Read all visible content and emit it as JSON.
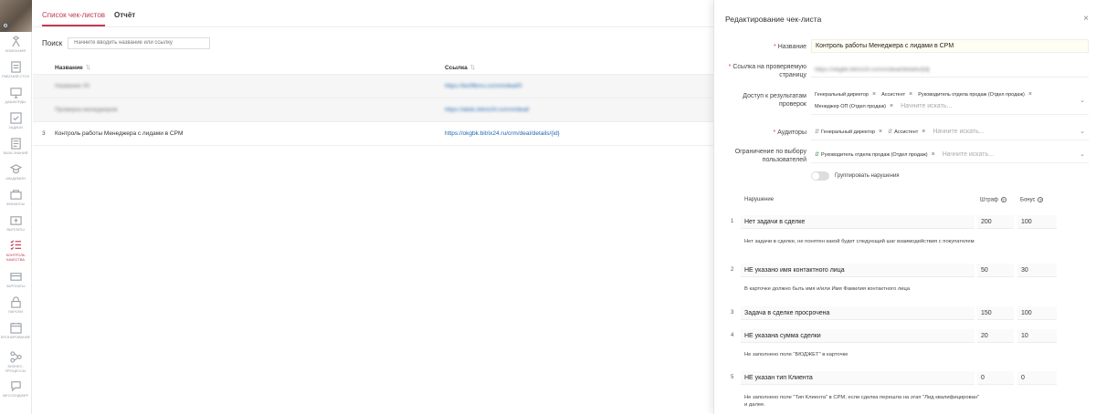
{
  "sidebar": {
    "items": [
      {
        "label": "КОМПАНИЯ",
        "icon": "company-icon"
      },
      {
        "label": "РАБОЧИЙ СТОЛ",
        "icon": "desktop-icon"
      },
      {
        "label": "ДАШБОРДЫ",
        "icon": "dashboard-icon"
      },
      {
        "label": "ЗАДАЧИ",
        "icon": "tasks-icon"
      },
      {
        "label": "БАЗА ЗНАНИЙ",
        "icon": "knowledge-icon"
      },
      {
        "label": "АКАДЕМИЯ",
        "icon": "academy-icon"
      },
      {
        "label": "ФИНАНСЫ",
        "icon": "finance-icon"
      },
      {
        "label": "ВЫПЛАТЫ",
        "icon": "payouts-icon"
      },
      {
        "label": "КОНТРОЛЬ",
        "label2": "КАЧЕСТВА",
        "icon": "quality-icon",
        "active": true
      },
      {
        "label": "ЗАРПЛАТЫ",
        "icon": "salary-icon"
      },
      {
        "label": "ПАРОЛИ",
        "icon": "passwords-icon"
      },
      {
        "label": "БРОНИРОВАНИЕ",
        "icon": "booking-icon"
      },
      {
        "label": "БИЗНЕС-",
        "label2": "ПРОЦЕССЫ",
        "icon": "process-icon"
      },
      {
        "label": "МЕССЕНДЖЕР",
        "icon": "messenger-icon"
      }
    ]
  },
  "tabs": {
    "checklists": "Список чек-листов",
    "report": "Отчёт"
  },
  "search": {
    "label": "Поиск",
    "placeholder": "Начните вводить название или ссылку"
  },
  "table": {
    "col_name": "Название",
    "col_link": "Ссылка",
    "sort_glyph": "⇅",
    "rows": [
      {
        "num": "",
        "name": "Название 00",
        "link": "https://bx0fbnru.ru/crm/deal/0",
        "blurred": true
      },
      {
        "num": "",
        "name": "Проверка менеджеров",
        "link": "https://abdc.bitrix24.ru/crm/deal/",
        "blurred": true
      },
      {
        "num": "3",
        "name": "Контроль работы Менеджера с лидами в CPM",
        "link": "https://okgbk.bitrix24.ru/crm/deal/details/{id}",
        "blurred": false
      }
    ]
  },
  "panel": {
    "title": "Редактирование чек-листа",
    "close": "×",
    "req": "*",
    "chev": "⌄",
    "name_label": "Название",
    "name_value": "Контроль работы Менеджера с лидами в CPM",
    "link_label": "Ссылка на проверяемую страницу",
    "link_value": "https://okgbk.bitrix24.ru/crm/deal/details/{id}",
    "access_label": "Доступ к результатам проверок",
    "access_tags": [
      "Генеральный директор",
      "Ассистент",
      "Руководитель отдела продаж (Отдел продаж)",
      "Менеджер ОП (Отдел продаж)"
    ],
    "placeholder": "Начните искать...",
    "auditors_label": "Аудиторы",
    "auditor_tags": [
      "Генеральный директор",
      "Ассистент"
    ],
    "restrict_label": "Ограничение по выбору пользователей",
    "restrict_tags": [
      "Руководитель отдела продаж (Отдел продаж)"
    ],
    "toggle_label": "Группировать нарушения",
    "violations_header": {
      "name": "Нарушение",
      "fine": "Штраф",
      "bonus": "Бонус",
      "help": "?"
    },
    "violations": [
      {
        "num": "1",
        "name": "Нет задачи в сделке",
        "fine": "200",
        "bonus": "100",
        "desc": "Нет задачи в сделке, не понятен какой будет следующий шаг взаимодействия с покупателем"
      },
      {
        "num": "2",
        "name": "НЕ указано имя контактного лица",
        "fine": "50",
        "bonus": "30",
        "desc": "В карточке должно быть имя и/или Имя Фамилия контактного лица"
      },
      {
        "num": "3",
        "name": "Задача в сделке просрочена",
        "fine": "150",
        "bonus": "100",
        "desc": ""
      },
      {
        "num": "4",
        "name": "НЕ указана сумма сделки",
        "fine": "20",
        "bonus": "10",
        "desc": "Не заполнено поле \"БЮДЖЕТ\" в карточке"
      },
      {
        "num": "5",
        "name": "НЕ указан тип Клиента",
        "fine": "0",
        "bonus": "0",
        "desc": "Не заполнено поле \"Тип Клиента\" в CPM, если сделка перешла на этап \"Лид квалифицирован\" и далее."
      }
    ]
  }
}
